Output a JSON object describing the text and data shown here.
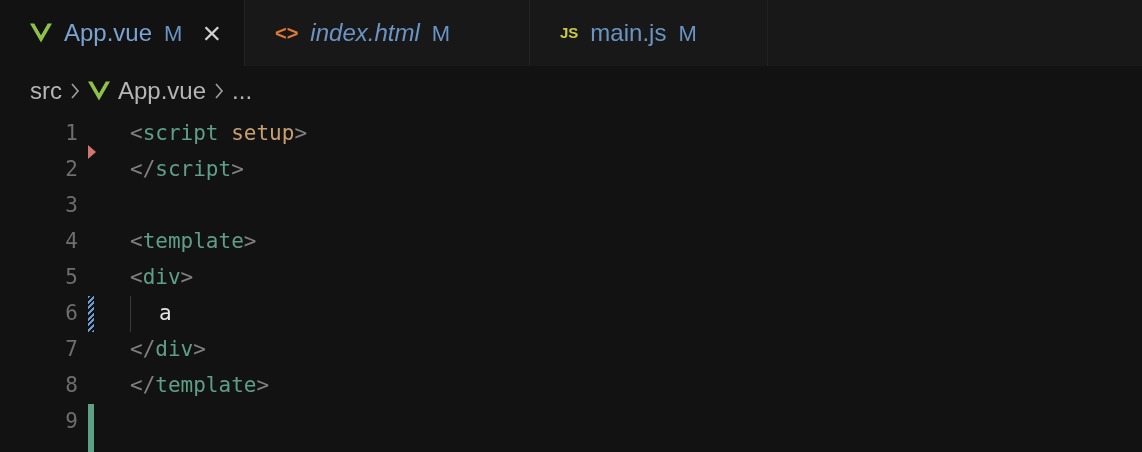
{
  "tabs": [
    {
      "kind": "vue",
      "name": "App.vue",
      "status": "M",
      "selected": true,
      "preview": false,
      "closable": true
    },
    {
      "kind": "html",
      "name": "index.html",
      "status": "M",
      "selected": false,
      "preview": true,
      "closable": false
    },
    {
      "kind": "js",
      "name": "main.js",
      "status": "M",
      "selected": false,
      "preview": false,
      "closable": false
    }
  ],
  "tab_icon_text": [
    "<>",
    "JS"
  ],
  "close_icon": "×",
  "breadcrumb": [
    {
      "kind": "folder",
      "label": "src"
    },
    {
      "kind": "vue",
      "label": "App.vue"
    },
    {
      "kind": "more",
      "label": "..."
    }
  ],
  "lines": [
    {
      "kind": "plain",
      "number": "1",
      "tokens": [
        {
          "kind": "punct",
          "text": "<"
        },
        {
          "kind": "tag",
          "text": "script"
        },
        {
          "kind": "attr",
          "text": "setup"
        },
        {
          "kind": "punct",
          "text": ">"
        }
      ]
    },
    {
      "kind": "deleted",
      "number": "2",
      "tokens": [
        {
          "kind": "punct",
          "text": "</"
        },
        {
          "kind": "tag",
          "text": "script"
        },
        {
          "kind": "punct",
          "text": ">"
        }
      ]
    },
    {
      "kind": "plain",
      "number": "3"
    },
    {
      "kind": "plain",
      "number": "4",
      "tokens": [
        {
          "kind": "punct",
          "text": "<"
        },
        {
          "kind": "tag",
          "text": "template"
        },
        {
          "kind": "punct",
          "text": ">"
        }
      ]
    },
    {
      "kind": "plain",
      "number": "5",
      "tokens": [
        {
          "kind": "punct",
          "text": "<"
        },
        {
          "kind": "tag",
          "text": "div"
        },
        {
          "kind": "punct",
          "text": ">"
        }
      ]
    },
    {
      "kind": "modified",
      "number": "6",
      "tokens": [
        {
          "kind": "indented",
          "text": "a"
        }
      ]
    },
    {
      "kind": "plain",
      "number": "7",
      "tokens": [
        {
          "kind": "punct",
          "text": "</"
        },
        {
          "kind": "tag",
          "text": "div"
        },
        {
          "kind": "punct",
          "text": ">"
        }
      ]
    },
    {
      "kind": "plain",
      "number": "8",
      "tokens": [
        {
          "kind": "punct",
          "text": "</"
        },
        {
          "kind": "tag",
          "text": "template"
        },
        {
          "kind": "punct",
          "text": ">"
        }
      ]
    },
    {
      "kind": "added",
      "number": "9"
    },
    {
      "kind": "added"
    }
  ]
}
